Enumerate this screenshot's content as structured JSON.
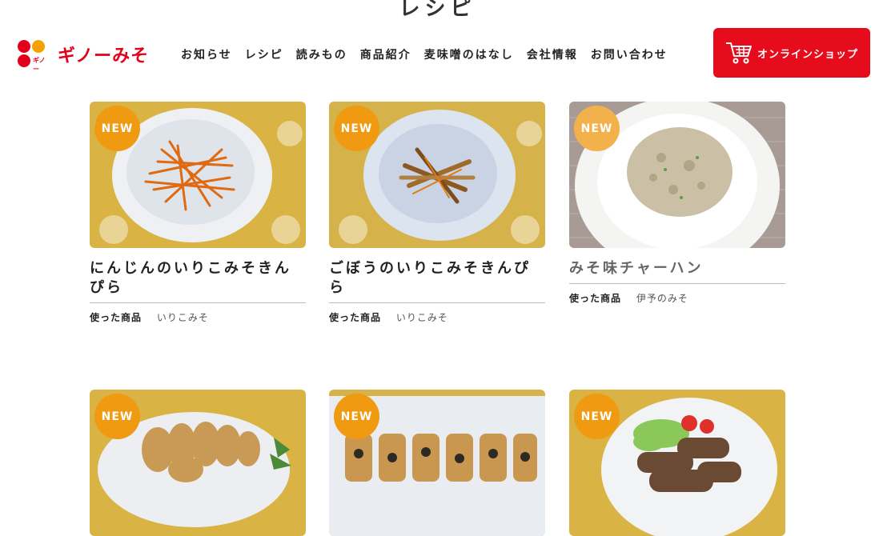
{
  "page": {
    "title": "レシピ"
  },
  "header": {
    "logo_text": "ギノーみそ",
    "logo_small": "ギノー",
    "nav": [
      "お知らせ",
      "レシピ",
      "読みもの",
      "商品紹介",
      "麦味噌のはなし",
      "会社情報",
      "お問い合わせ"
    ],
    "shop_label": "オンラインショップ",
    "colors": {
      "brand_red": "#e3001b",
      "shop_red": "#e60c1c",
      "badge_orange": "#f09a12"
    }
  },
  "labels": {
    "used_products": "使った商品",
    "new_badge": "NEW"
  },
  "recipes": [
    {
      "badge": "NEW",
      "title": "にんじんのいりこみそきんぴら",
      "used_label": "使った商品",
      "used": "いりこみそ",
      "image": "carrot-kinpira-bowl"
    },
    {
      "badge": "NEW",
      "title": "ごぼうのいりこみそきんぴら",
      "used_label": "使った商品",
      "used": "いりこみそ",
      "image": "burdock-kinpira-bowl"
    },
    {
      "badge": "NEW",
      "title": "みそ味チャーハン",
      "used_label": "使った商品",
      "used": "伊予のみそ",
      "image": "miso-fried-rice-plate"
    },
    {
      "badge": "NEW",
      "image": "fried-tofu-pouches-plate"
    },
    {
      "badge": "NEW",
      "image": "rolled-fried-tofu-tray"
    },
    {
      "badge": "NEW",
      "image": "meat-rolls-salad-plate"
    }
  ]
}
